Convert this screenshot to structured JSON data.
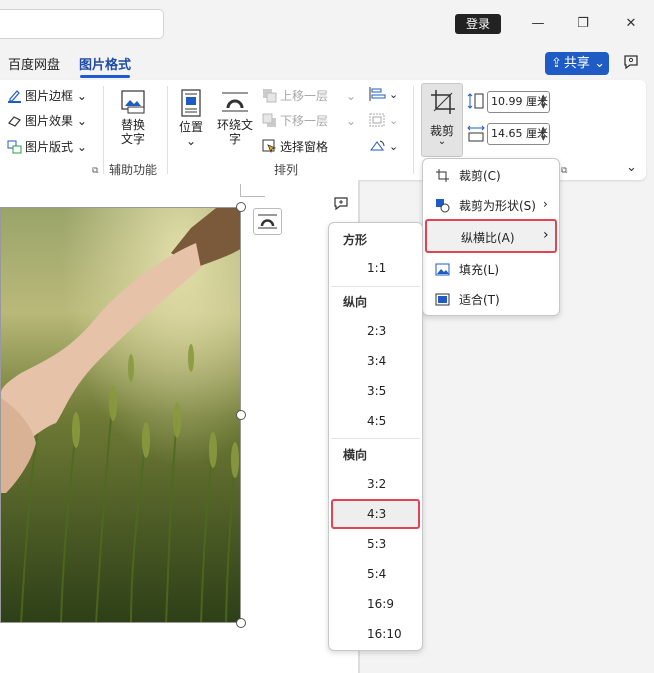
{
  "titlebar": {
    "login_label": "登录",
    "minimize": "—",
    "restore": "❐",
    "close": "✕"
  },
  "tabs": [
    {
      "label": "百度网盘"
    },
    {
      "label": "图片格式"
    }
  ],
  "share": {
    "label": "共享",
    "chevron": "⌄"
  },
  "ribbon": {
    "picture_border": "图片边框",
    "picture_effects": "图片效果",
    "picture_layout": "图片版式",
    "alt_text_line1": "替换",
    "alt_text_line2": "文字",
    "accessibility_group": "辅助功能",
    "position": "位置",
    "wrap_text_line1": "环绕文",
    "wrap_text_line2": "字",
    "bring_forward": "上移一层",
    "send_backward": "下移一层",
    "selection_pane": "选择窗格",
    "arrange_group": "排列",
    "crop": "裁剪",
    "height_value": "10.99 厘米",
    "width_value": "14.65 厘米"
  },
  "crop_menu": {
    "items": [
      {
        "label": "裁剪(C)"
      },
      {
        "label": "裁剪为形状(S)"
      },
      {
        "label": "纵横比(A)"
      },
      {
        "label": "填充(L)"
      },
      {
        "label": "适合(T)"
      }
    ]
  },
  "aspect_menu": {
    "square_header": "方形",
    "square": [
      "1:1"
    ],
    "portrait_header": "纵向",
    "portrait": [
      "2:3",
      "3:4",
      "3:5",
      "4:5"
    ],
    "landscape_header": "横向",
    "landscape": [
      "3:2",
      "4:3",
      "5:3",
      "5:4",
      "16:9",
      "16:10"
    ]
  },
  "colors": {
    "accent": "#1e5bc4",
    "highlight": "#e04555"
  }
}
